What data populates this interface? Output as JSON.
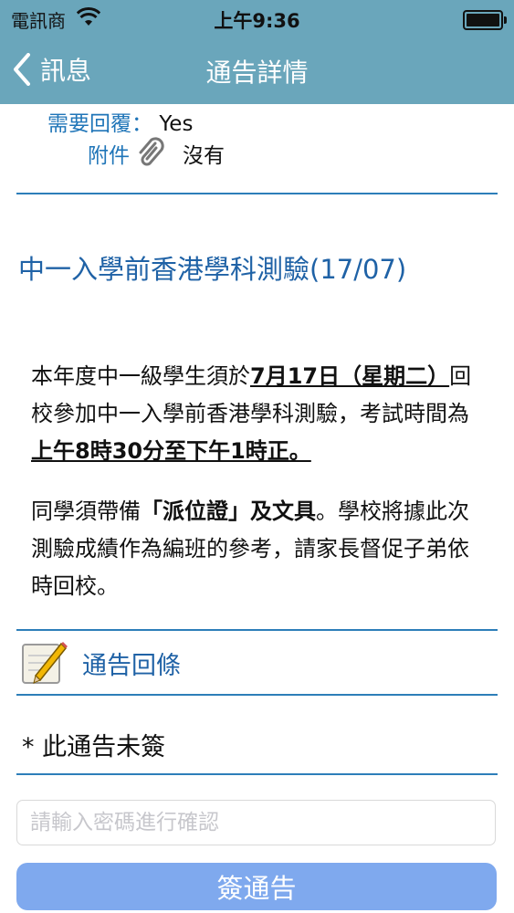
{
  "status_bar": {
    "carrier": "電訊商",
    "time": "上午9:36",
    "wifi_icon": "wifi-icon",
    "battery_icon": "battery-icon"
  },
  "nav": {
    "back_label": "訊息",
    "title": "通告詳情"
  },
  "meta": {
    "reply_needed_label": "需要回覆：",
    "reply_needed_value": "Yes",
    "attachment_label": "附件",
    "attachment_value": "沒有"
  },
  "notice": {
    "title": "中一入學前香港學科測驗(17/07)",
    "p1_a": "本年度中一級學生須於",
    "p1_b": "7月17日（星期二）",
    "p1_c": "回校參加中一入學前香港學科測驗，考試時間為",
    "p1_d": "上午8時30分至下午1時正。",
    "p2_a": "同學須帶備",
    "p2_b": "「派位證」及文具",
    "p2_c": "。學校將據此次測驗成績作為編班的參考，請家長督促子弟依時回校。"
  },
  "reply_section": {
    "label": "通告回條",
    "status": "* 此通告未簽"
  },
  "form": {
    "password_placeholder": "請輸入密碼進行確認",
    "password_value": "",
    "sign_button": "簽通告"
  },
  "colors": {
    "nav_bg": "#6aa6bb",
    "link_blue": "#1f75b8",
    "title_blue": "#1f62a6",
    "button_bg": "#7fa9ee"
  }
}
